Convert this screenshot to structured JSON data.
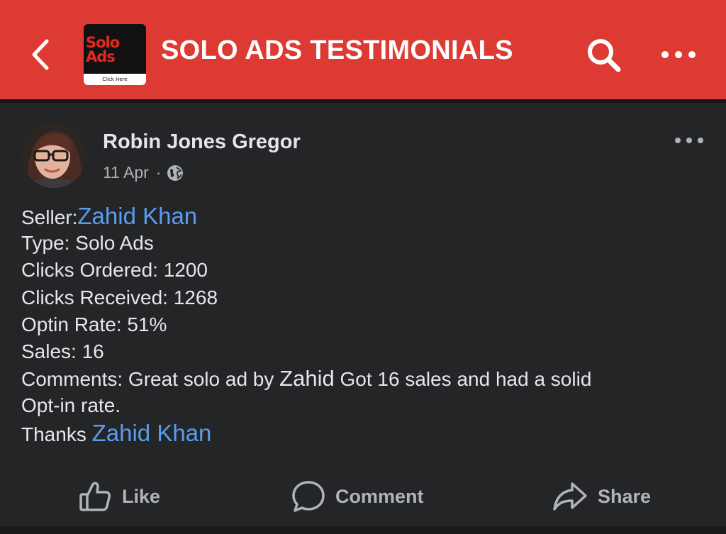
{
  "header": {
    "title": "SOLO ADS TESTIMONIALS",
    "logo_text": "Solo\nAds",
    "logo_caption": "Click Here",
    "back_icon": "chevron-left-icon",
    "search_icon": "search-icon",
    "more_icon": "more-horizontal-icon",
    "background_color": "#dc3a32"
  },
  "post": {
    "author": "Robin Jones Gregor",
    "date": "11 Apr",
    "separator": "·",
    "privacy_icon": "globe-icon",
    "more_icon": "more-horizontal-icon",
    "body": {
      "seller_label": "Seller:",
      "seller_name": "Zahid Khan",
      "type": "Type: Solo Ads",
      "clicks_ordered": "Clicks Ordered: 1200",
      "clicks_received": "Clicks Received: 1268",
      "optin_rate": "Optin Rate: 51%",
      "sales": "Sales: 16",
      "comments_prefix": "Comments: Great solo ad by",
      "comments_mention": "Zahid",
      "comments_suffix": "Got 16 sales and had a solid",
      "comments_line2": "Opt-in rate.",
      "thanks_prefix": "Thanks",
      "thanks_name": "Zahid Khan"
    }
  },
  "actions": {
    "like": {
      "label": "Like",
      "icon": "thumbs-up-icon"
    },
    "comment": {
      "label": "Comment",
      "icon": "comment-bubble-icon"
    },
    "share": {
      "label": "Share",
      "icon": "share-arrow-icon"
    }
  },
  "colors": {
    "background": "#242526",
    "text": "#e4e6eb",
    "secondary_text": "#b0b3b8",
    "link": "#5a9cf0"
  }
}
